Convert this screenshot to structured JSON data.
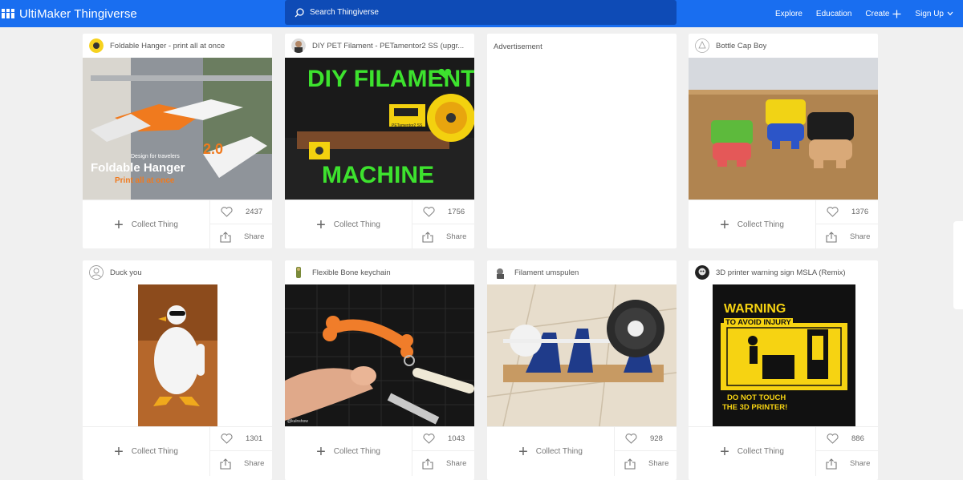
{
  "header": {
    "brand": "UltiMaker Thingiverse",
    "search_placeholder": "Search Thingiverse",
    "nav": {
      "explore": "Explore",
      "education": "Education",
      "create": "Create",
      "signup": "Sign Up"
    }
  },
  "cards": [
    {
      "title": "Foldable Hanger - print all at once",
      "likes": "2437",
      "collect": "Collect Thing",
      "share": "Share",
      "thumb_text": {
        "badge": "Design for travelers",
        "version": "2.0",
        "name": "Foldable Hanger",
        "sub": "Print all at once"
      }
    },
    {
      "title": "DIY PET Filament - PETamentor2 SS (upgr...",
      "likes": "1756",
      "collect": "Collect Thing",
      "share": "Share",
      "thumb_text": {
        "top": "DIY FILAMENT",
        "bottom": "MACHINE",
        "device": "PETamentor2 SS"
      }
    },
    {
      "advertisement": "Advertisement"
    },
    {
      "title": "Bottle Cap Boy",
      "likes": "1376",
      "collect": "Collect Thing",
      "share": "Share"
    },
    {
      "title": "Duck you",
      "likes": "1301",
      "collect": "Collect Thing",
      "share": "Share"
    },
    {
      "title": "Flexible Bone keychain",
      "likes": "1043",
      "collect": "Collect Thing",
      "share": "Share",
      "thumb_text": {
        "watermark": "@kulnshow"
      }
    },
    {
      "title": "Filament umspulen",
      "likes": "928",
      "collect": "Collect Thing",
      "share": "Share"
    },
    {
      "title": "3D printer warning sign MSLA (Remix)",
      "likes": "886",
      "collect": "Collect Thing",
      "share": "Share",
      "thumb_text": {
        "warning": "WARNING",
        "line2": "TO AVOID INJURY",
        "line3": "DO NOT TOUCH",
        "line4": "THE 3D PRINTER!"
      }
    }
  ],
  "colors": {
    "brand_blue": "#196ef0",
    "search_bg": "#0e4bb6",
    "page_bg": "#f0f0f0"
  },
  "icons": [
    "ultimaker-logo-icon",
    "search-icon",
    "plus-icon",
    "heart-icon",
    "share-icon",
    "user-avatar-icon"
  ]
}
